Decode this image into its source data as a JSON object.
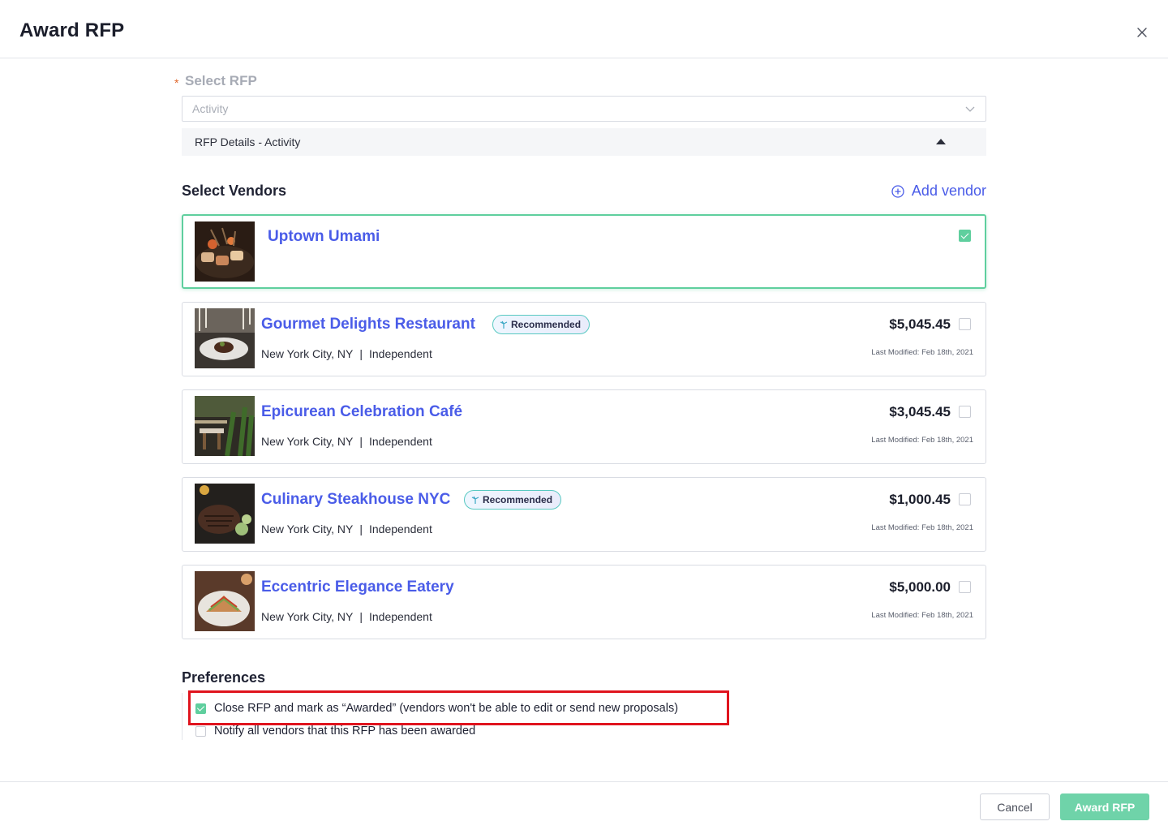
{
  "modal": {
    "title": "Award RFP",
    "close_label": "close"
  },
  "select_rfp": {
    "label": "Select RFP",
    "required_mark": "*",
    "value": "Activity",
    "details_label": "RFP Details - Activity"
  },
  "vendors": {
    "heading": "Select Vendors",
    "add_label": "Add vendor",
    "badge_label": "Recommended",
    "items": [
      {
        "name": "Uptown Umami",
        "selected": true
      },
      {
        "name": "Gourmet Delights Restaurant",
        "recommended": true,
        "city": "New York City, NY",
        "sep": "|",
        "type": "Independent",
        "price": "$5,045.45",
        "modified": "Last Modified: Feb 18th, 2021",
        "selected": false
      },
      {
        "name": "Epicurean Celebration Café",
        "recommended": false,
        "city": "New York City, NY",
        "sep": "|",
        "type": "Independent",
        "price": "$3,045.45",
        "modified": "Last Modified: Feb 18th, 2021",
        "selected": false
      },
      {
        "name": "Culinary Steakhouse NYC",
        "recommended": true,
        "city": "New York City, NY",
        "sep": "|",
        "type": "Independent",
        "price": "$1,000.45",
        "modified": "Last Modified: Feb 18th, 2021",
        "selected": false
      },
      {
        "name": "Eccentric Elegance Eatery",
        "recommended": false,
        "city": "New York City, NY",
        "sep": "|",
        "type": "Independent",
        "price": "$5,000.00",
        "modified": "Last Modified: Feb 18th, 2021",
        "selected": false
      }
    ]
  },
  "preferences": {
    "heading": "Preferences",
    "options": [
      {
        "label": "Close RFP and mark as “Awarded” (vendors won't be able to edit or send new proposals)",
        "checked": true
      },
      {
        "label": "Notify all vendors that this RFP has been awarded",
        "checked": false
      }
    ]
  },
  "footer": {
    "cancel_label": "Cancel",
    "award_label": "Award RFP"
  },
  "colors": {
    "accent_blue": "#4a5ce8",
    "success_green": "#5fcf9e",
    "highlight_red": "#e0141e"
  }
}
